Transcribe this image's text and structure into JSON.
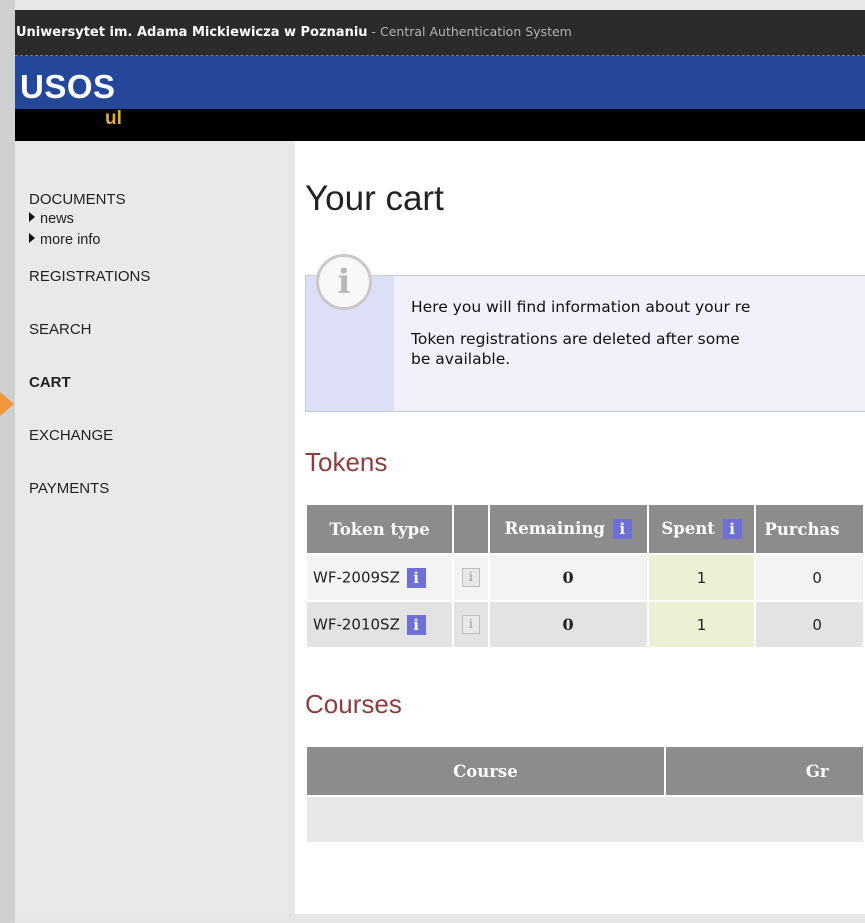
{
  "window": {
    "title_bold": "Uniwersytet im. Adama Mickiewicza w Poznaniu",
    "title_rest": " - Central Authentication System"
  },
  "header": {
    "logo": "USOS",
    "logo_sub": "ul",
    "colors": {
      "blue": "#25479a",
      "black": "#000000",
      "accent": "#e7a83c"
    }
  },
  "sidebar": {
    "documents": "DOCUMENTS",
    "documents_sub": [
      "news",
      "more info"
    ],
    "items": [
      "REGISTRATIONS",
      "SEARCH",
      "CART",
      "EXCHANGE",
      "PAYMENTS"
    ],
    "active": "CART"
  },
  "main": {
    "title": "Your cart",
    "info_icon": "i",
    "info_lines": [
      "Here you will find information about your re",
      "Token registrations are deleted after some ",
      "be available."
    ]
  },
  "tokens": {
    "heading": "Tokens",
    "headers": [
      "Token type",
      "",
      "Remaining",
      "Spent",
      "Purchas"
    ],
    "info_glyph": "i",
    "rows": [
      {
        "type": "WF-2009SZ",
        "remaining": "0",
        "spent": "1",
        "purchased": "0"
      },
      {
        "type": "WF-2010SZ",
        "remaining": "0",
        "spent": "1",
        "purchased": "0"
      }
    ]
  },
  "courses": {
    "heading": "Courses",
    "headers": [
      "Course",
      "Gr"
    ]
  }
}
